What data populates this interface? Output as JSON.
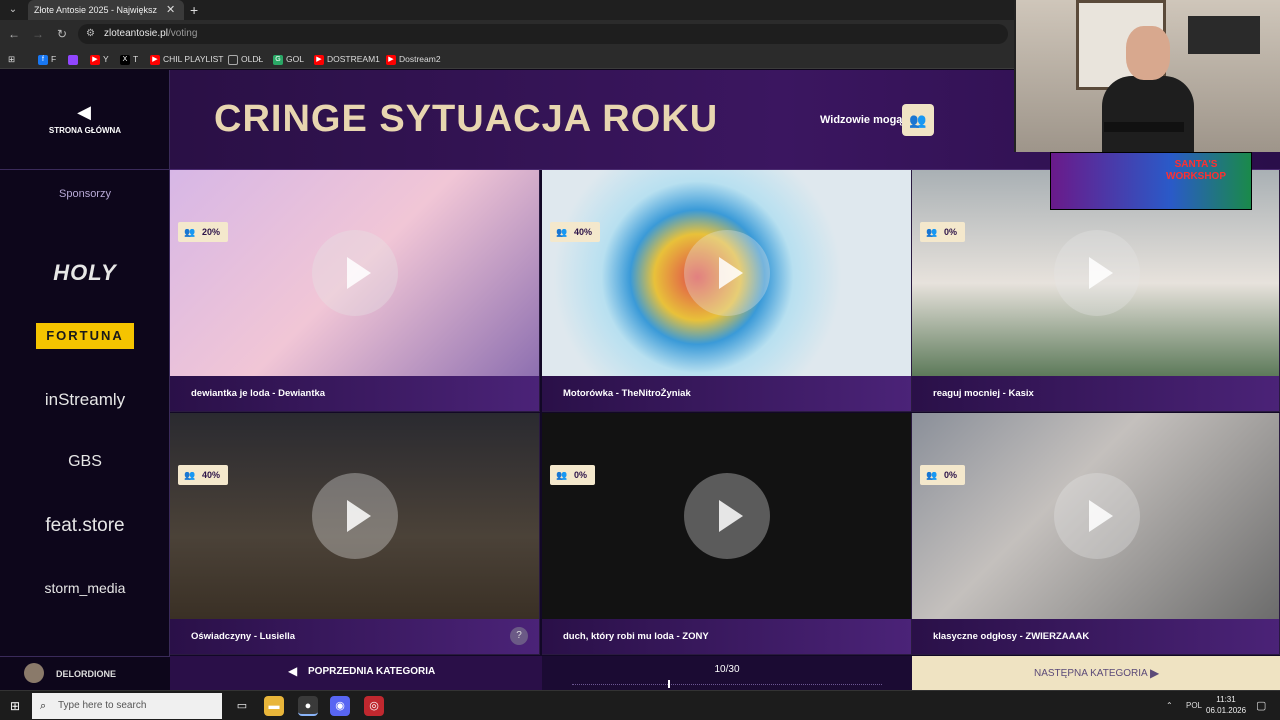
{
  "browser": {
    "tab_title": "Złote Antosie 2025 - Największ",
    "url_domain": "zloteantosie.pl",
    "url_path": "/voting",
    "bookmarks": [
      {
        "label": "F",
        "icon": "facebook-icon",
        "color": "#1877f2"
      },
      {
        "label": "",
        "icon": "twitch-icon",
        "color": "#9146ff"
      },
      {
        "label": "Y",
        "icon": "youtube-icon",
        "color": "#ff0000"
      },
      {
        "label": "T",
        "icon": "x-icon",
        "color": "#000000"
      },
      {
        "label": "CHIL PLAYLIST",
        "icon": "youtube-icon",
        "color": "#ff0000"
      },
      {
        "label": "OLDŁ",
        "icon": "folder-icon",
        "color": "#888888"
      },
      {
        "label": "GOL",
        "icon": "gol-icon",
        "color": "#2aa866"
      },
      {
        "label": "DOSTREAM1",
        "icon": "youtube-icon",
        "color": "#ff0000"
      },
      {
        "label": "Dostream2",
        "icon": "youtube-icon",
        "color": "#ff0000"
      }
    ]
  },
  "sidebar": {
    "home_label": "STRONA GŁÓWNA",
    "sponsors_title": "Sponsorzy",
    "sponsors": [
      "HOLY",
      "FORTUNA",
      "inStreamly",
      "GBS",
      "feat.store",
      "storm_media"
    ],
    "user": "DELORDIONE"
  },
  "header": {
    "category_title": "CRINGE SYTUACJA ROKU",
    "viewers_label": "Widzowie mogą"
  },
  "nominees": [
    {
      "caption": "dewiantka je loda - Dewiantka",
      "percent": "20%"
    },
    {
      "caption": "Motorówka - TheNitroŻyniak",
      "percent": "40%"
    },
    {
      "caption": "reaguj mocniej - Kasix",
      "percent": "0%"
    },
    {
      "caption": "Oświadczyny - Lusiella",
      "percent": "40%"
    },
    {
      "caption": "duch, który robi mu loda - ZONY",
      "percent": "0%"
    },
    {
      "caption": "klasyczne odgłosy - ZWIERZAAAK",
      "percent": "0%"
    }
  ],
  "footer": {
    "prev_label": "POPRZEDNIA KATEGORIA",
    "progress": "10/30",
    "next_label": "NASTĘPNA KATEGORIA"
  },
  "overlay": {
    "santa_text": "SANTA'S WORKSHOP"
  },
  "taskbar": {
    "search_placeholder": "Type here to search",
    "lang": "POL",
    "time": "11:31",
    "date": "06.01.2026"
  },
  "colors": {
    "accent": "#f0e3c4",
    "title": "#e8d6b0",
    "caption_bg": "#4b2378"
  }
}
